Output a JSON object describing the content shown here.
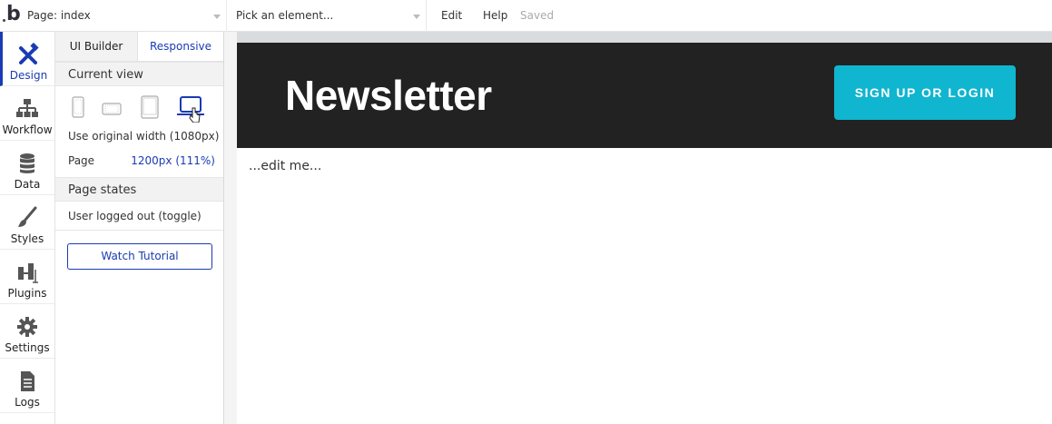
{
  "topbar": {
    "logo": "b",
    "page_select": "Page: index",
    "element_select": "Pick an element...",
    "menu_edit": "Edit",
    "menu_help": "Help",
    "status": "Saved"
  },
  "rail": {
    "items": [
      {
        "label": "Design",
        "icon": "design-icon"
      },
      {
        "label": "Workflow",
        "icon": "workflow-icon"
      },
      {
        "label": "Data",
        "icon": "database-icon"
      },
      {
        "label": "Styles",
        "icon": "brush-icon"
      },
      {
        "label": "Plugins",
        "icon": "plugin-icon"
      },
      {
        "label": "Settings",
        "icon": "gear-icon"
      },
      {
        "label": "Logs",
        "icon": "document-icon"
      }
    ]
  },
  "panel": {
    "tabs": [
      "UI Builder",
      "Responsive"
    ],
    "current_view_title": "Current view",
    "devices": [
      "phone-portrait-icon",
      "phone-landscape-icon",
      "tablet-icon",
      "desktop-icon"
    ],
    "original_width": "Use original width (1080px)",
    "page_label": "Page",
    "page_value": "1200px (111%)",
    "page_states_title": "Page states",
    "state_item": "User logged out (toggle)",
    "watch_tutorial": "Watch Tutorial"
  },
  "canvas": {
    "title": "Newsletter",
    "signup_button": "SIGN UP OR LOGIN",
    "edit_text": "...edit me..."
  },
  "colors": {
    "accent": "#1a3bb3",
    "header_bg": "#222222",
    "button_bg": "#10b5cf"
  }
}
